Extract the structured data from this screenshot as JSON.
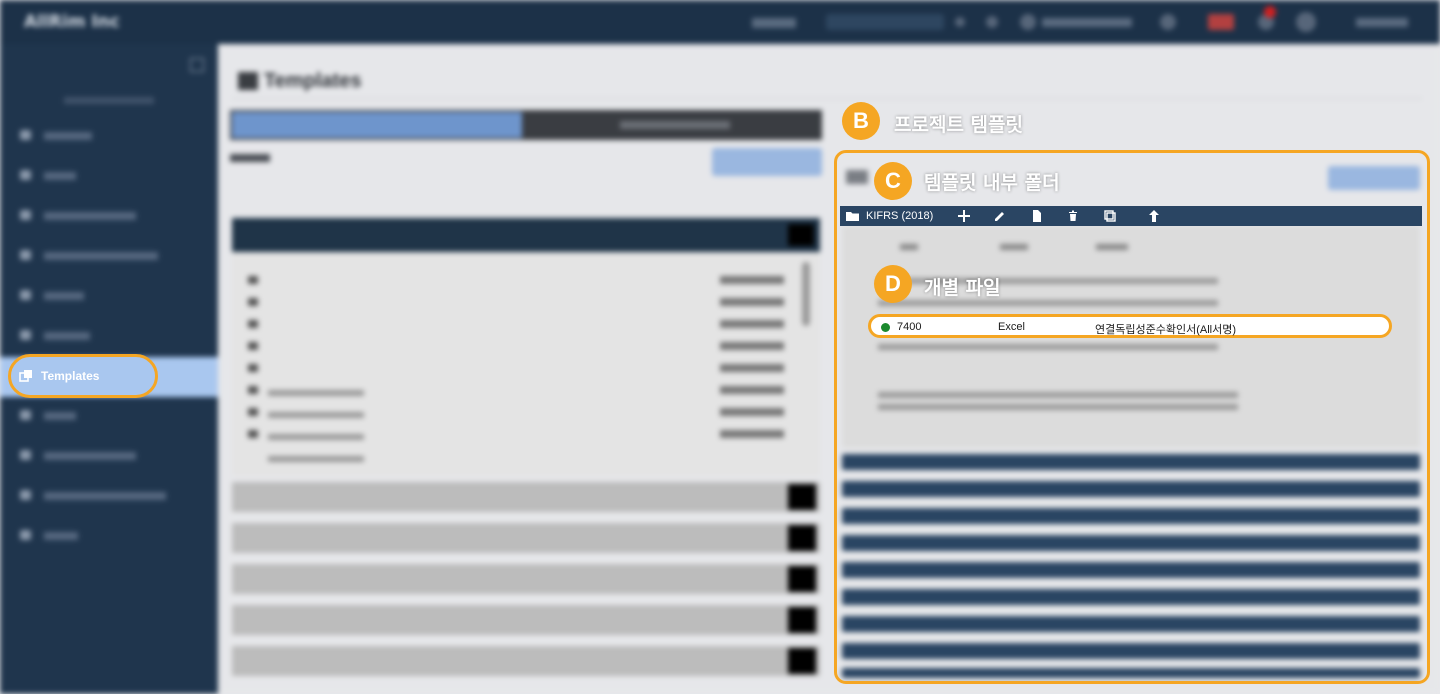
{
  "app": {
    "brand": "AllRim Inc"
  },
  "sidebar": {
    "active_item": "Templates"
  },
  "main": {
    "page_title": "Templates"
  },
  "folder": {
    "name": "KIFRS (2018)"
  },
  "highlighted_file": {
    "code": "7400",
    "type": "Excel",
    "name": "연결독립성준수확인서(All서명)"
  },
  "callouts": {
    "b": {
      "letter": "B",
      "text": "프로젝트 템플릿"
    },
    "c": {
      "letter": "C",
      "text": "템플릿 내부 폴더"
    },
    "d": {
      "letter": "D",
      "text": "개별 파일"
    }
  },
  "colors": {
    "accent": "#f5a623",
    "navy": "#1c3148",
    "status_green": "#1c8a2e"
  }
}
